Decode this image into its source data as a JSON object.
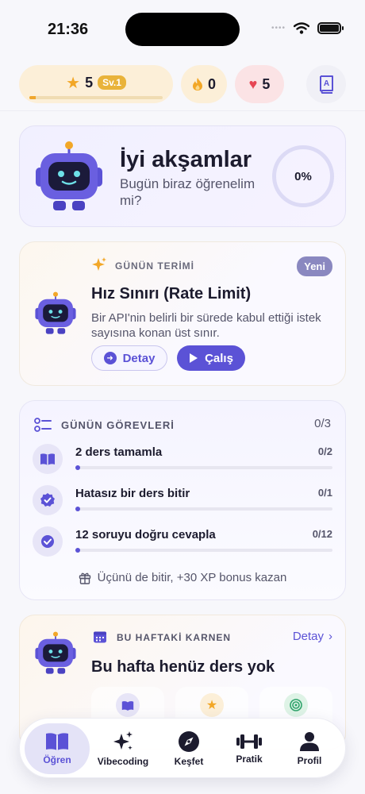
{
  "status_bar": {
    "time": "21:36"
  },
  "top_bar": {
    "level_stars": "5",
    "level_badge": "Sv.1",
    "xp_progress": 0.05,
    "streak": "0",
    "hearts": "5"
  },
  "greeting": {
    "title": "İyi akşamlar",
    "subtitle": "Bugün biraz öğrenelim mi?",
    "progress": "0%"
  },
  "term": {
    "label": "GÜNÜN TERİMİ",
    "badge": "Yeni",
    "title": "Hız Sınırı (Rate Limit)",
    "description": "Bir API'nin belirli bir sürede kabul ettiği istek sayısına konan üst sınır.",
    "detail_button": "Detay",
    "study_button": "Çalış"
  },
  "tasks": {
    "title": "GÜNÜN GÖREVLERİ",
    "count": "0/3",
    "items": [
      {
        "label": "2 ders tamamla",
        "progress": "0/2",
        "icon": "book-icon"
      },
      {
        "label": "Hatasız bir ders bitir",
        "progress": "0/1",
        "icon": "verified-badge-icon"
      },
      {
        "label": "12 soruyu doğru cevapla",
        "progress": "0/12",
        "icon": "check-circle-icon"
      }
    ],
    "bonus": "Üçünü de bitir, +30 XP bonus kazan"
  },
  "weekly": {
    "label": "BU HAFTAKİ KARNEN",
    "link": "Detay",
    "title": "Bu hafta henüz ders yok"
  },
  "tabs": [
    {
      "label": "Öğren",
      "icon": "open-book-icon",
      "active": true
    },
    {
      "label": "Vibecoding",
      "icon": "sparkles-icon",
      "active": false
    },
    {
      "label": "Keşfet",
      "icon": "compass-icon",
      "active": false
    },
    {
      "label": "Pratik",
      "icon": "dumbbell-icon",
      "active": false
    },
    {
      "label": "Profil",
      "icon": "person-icon",
      "active": false
    }
  ],
  "colors": {
    "accent": "#5b52d6",
    "streak": "#f2a727",
    "heart": "#e64654"
  }
}
